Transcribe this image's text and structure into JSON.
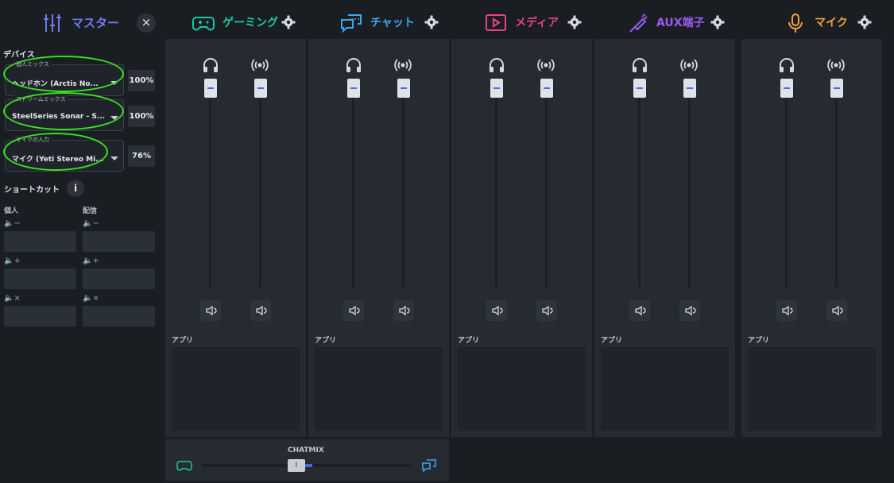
{
  "master": {
    "title": "マスター",
    "close_icon": "×",
    "devices_label": "デバイス",
    "devices": [
      {
        "caption": "個人ミックス",
        "value": "ヘッドホン (Arctis No...",
        "percent": "100%"
      },
      {
        "caption": "ストリームミックス",
        "value": "SteelSeries Sonar - S...",
        "percent": "100%"
      },
      {
        "caption": "マイクの入力",
        "value": "マイク (Yeti Stereo Mi...",
        "percent": "76%"
      }
    ],
    "shortcuts_label": "ショートカット",
    "info_icon": "i",
    "col_personal": "個人",
    "col_stream": "配信",
    "shortcut_icons": [
      "🔈−",
      "🔈+",
      "🔈×"
    ]
  },
  "channels": [
    {
      "id": "gaming",
      "title": "ゲーミング",
      "color": "#19c7a8",
      "icon": "gamepad-icon"
    },
    {
      "id": "chat",
      "title": "チャット",
      "color": "#3aa9e8",
      "icon": "chat-icon"
    },
    {
      "id": "media",
      "title": "メディア",
      "color": "#e8408e",
      "icon": "play-icon"
    },
    {
      "id": "aux",
      "title": "AUX端子",
      "color": "#9a5cf0",
      "icon": "aux-cable-icon"
    },
    {
      "id": "mic",
      "title": "マイク",
      "color": "#f0a23a",
      "icon": "microphone-icon"
    }
  ],
  "apps_label": "アプリ",
  "chatmix": {
    "label": "CHATMIX",
    "knob_glyph": "I",
    "balance": 0.45
  }
}
